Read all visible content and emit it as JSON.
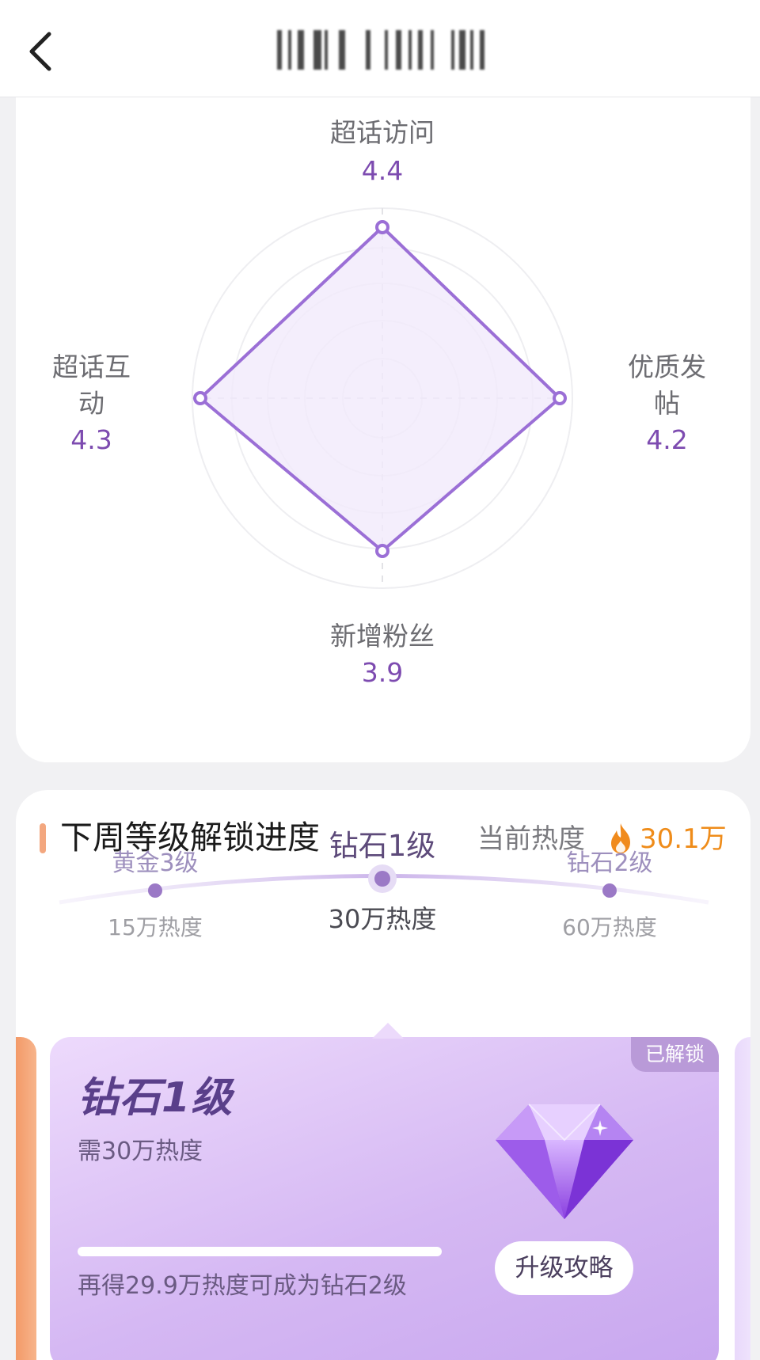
{
  "header": {
    "title": "",
    "back_icon": "chevron-left-icon"
  },
  "radar": {
    "axes": [
      {
        "label": "超话访问",
        "value": "4.4"
      },
      {
        "label": "优质发帖",
        "value": "4.2"
      },
      {
        "label": "新增粉丝",
        "value": "3.9"
      },
      {
        "label": "超话互动",
        "value": "4.3"
      }
    ],
    "colors": {
      "line": "#9b6fd6",
      "fill": "#efe7fb",
      "grid": "#ededf0"
    }
  },
  "unlock": {
    "section_title": "下周等级解锁进度",
    "heat_label": "当前热度",
    "heat_value": "30.1万",
    "heat_icon": "flame-icon",
    "levels": [
      {
        "name": "黄金3级",
        "requirement": "15万热度"
      },
      {
        "name": "钻石1级",
        "requirement": "30万热度"
      },
      {
        "name": "钻石2级",
        "requirement": "60万热度"
      }
    ],
    "card": {
      "badge": "已解锁",
      "level": "钻石1级",
      "need": "需30万热度",
      "progress": 1.0,
      "hint": "再得29.9万热度可成为钻石2级",
      "button": "升级攻略",
      "icon": "diamond-icon"
    },
    "colors": {
      "accent": "#ef8c1a",
      "purple": "#7d4bb0"
    }
  }
}
